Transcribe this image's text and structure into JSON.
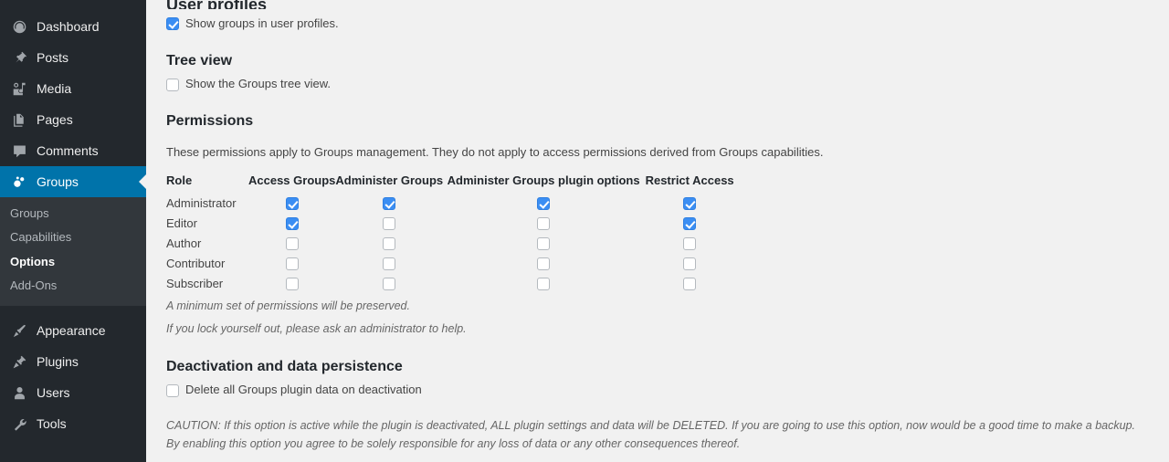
{
  "sidebar": {
    "items": [
      {
        "label": "Dashboard",
        "icon": "dashboard-icon",
        "current": false
      },
      {
        "label": "Posts",
        "icon": "pin-icon",
        "current": false
      },
      {
        "label": "Media",
        "icon": "media-icon",
        "current": false
      },
      {
        "label": "Pages",
        "icon": "pages-icon",
        "current": false
      },
      {
        "label": "Comments",
        "icon": "comment-icon",
        "current": false
      },
      {
        "label": "Groups",
        "icon": "groups-icon",
        "current": true
      }
    ],
    "submenu": [
      {
        "label": "Groups",
        "current": false
      },
      {
        "label": "Capabilities",
        "current": false
      },
      {
        "label": "Options",
        "current": true
      },
      {
        "label": "Add-Ons",
        "current": false
      }
    ],
    "items_lower": [
      {
        "label": "Appearance",
        "icon": "paintbrush-icon",
        "current": false
      },
      {
        "label": "Plugins",
        "icon": "plug-icon",
        "current": false
      },
      {
        "label": "Users",
        "icon": "user-icon",
        "current": false
      },
      {
        "label": "Tools",
        "icon": "wrench-icon",
        "current": false
      }
    ]
  },
  "main": {
    "clipped_heading": "User profiles",
    "show_groups_profiles": {
      "label": "Show groups in user profiles.",
      "checked": true
    },
    "tree_view": {
      "heading": "Tree view",
      "label": "Show the Groups tree view.",
      "checked": false
    },
    "permissions": {
      "heading": "Permissions",
      "description": "These permissions apply to Groups management. They do not apply to access permissions derived from Groups capabilities.",
      "columns": [
        "Role",
        "Access Groups",
        "Administer Groups",
        "Administer Groups plugin options",
        "Restrict Access"
      ],
      "rows": [
        {
          "role": "Administrator",
          "values": [
            true,
            true,
            true,
            true
          ]
        },
        {
          "role": "Editor",
          "values": [
            true,
            false,
            false,
            true
          ]
        },
        {
          "role": "Author",
          "values": [
            false,
            false,
            false,
            false
          ]
        },
        {
          "role": "Contributor",
          "values": [
            false,
            false,
            false,
            false
          ]
        },
        {
          "role": "Subscriber",
          "values": [
            false,
            false,
            false,
            false
          ]
        }
      ],
      "notes": [
        "A minimum set of permissions will be preserved.",
        "If you lock yourself out, please ask an administrator to help."
      ]
    },
    "deactivation": {
      "heading": "Deactivation and data persistence",
      "label": "Delete all Groups plugin data on deactivation",
      "checked": false,
      "caution": "CAUTION: If this option is active while the plugin is deactivated, ALL plugin settings and data will be DELETED. If you are going to use this option, now would be a good time to make a backup. By enabling this option you agree to be solely responsible for any loss of data or any other consequences thereof."
    }
  },
  "colors": {
    "sidebar_bg": "#23282d",
    "submenu_bg": "#32373c",
    "active_blue": "#0073aa",
    "content_bg": "#f1f1f1",
    "checkbox_blue": "#3b8ef3"
  }
}
